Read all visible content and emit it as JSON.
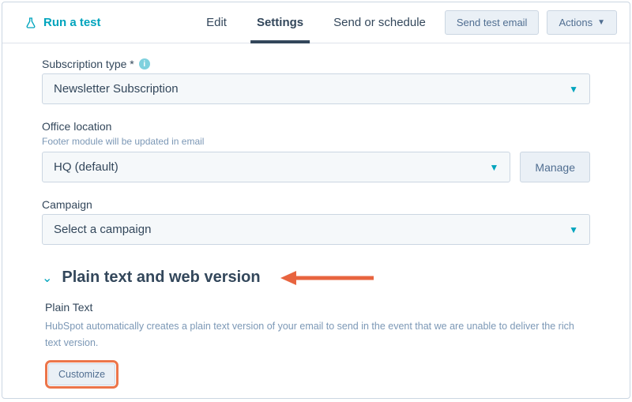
{
  "header": {
    "run_test": "Run a test",
    "tabs": {
      "edit": "Edit",
      "settings": "Settings",
      "send": "Send or schedule"
    },
    "send_test_email": "Send test email",
    "actions": "Actions"
  },
  "fields": {
    "subscription": {
      "label": "Subscription type *",
      "value": "Newsletter Subscription"
    },
    "office": {
      "label": "Office location",
      "hint": "Footer module will be updated in email",
      "value": "HQ (default)",
      "manage": "Manage"
    },
    "campaign": {
      "label": "Campaign",
      "value": "Select a campaign"
    }
  },
  "section": {
    "title": "Plain text and web version",
    "plain_text": {
      "title": "Plain Text",
      "desc": "HubSpot automatically creates a plain text version of your email to send in the event that we are unable to deliver the rich text version.",
      "customize": "Customize"
    }
  }
}
